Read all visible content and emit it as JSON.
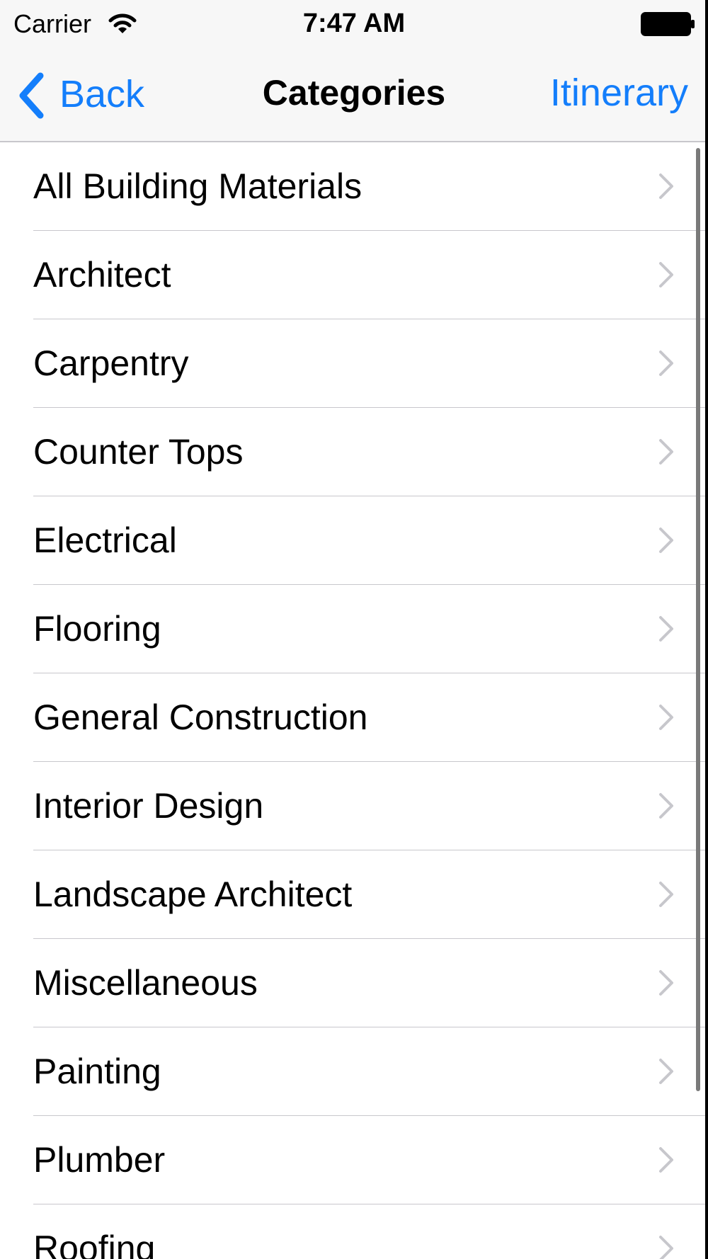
{
  "status_bar": {
    "carrier": "Carrier",
    "time": "7:47 AM",
    "wifi_icon": "wifi-icon",
    "battery_icon": "battery-full-icon"
  },
  "nav_bar": {
    "back_label": "Back",
    "title": "Categories",
    "right_button_label": "Itinerary",
    "accent_color": "#147efb"
  },
  "categories": [
    {
      "label": "All Building Materials"
    },
    {
      "label": "Architect"
    },
    {
      "label": "Carpentry"
    },
    {
      "label": "Counter Tops"
    },
    {
      "label": "Electrical"
    },
    {
      "label": "Flooring"
    },
    {
      "label": "General Construction"
    },
    {
      "label": "Interior Design"
    },
    {
      "label": "Landscape Architect"
    },
    {
      "label": "Miscellaneous"
    },
    {
      "label": "Painting"
    },
    {
      "label": "Plumber"
    },
    {
      "label": "Roofing"
    }
  ],
  "row_accessory_icon": "chevron-right-icon"
}
